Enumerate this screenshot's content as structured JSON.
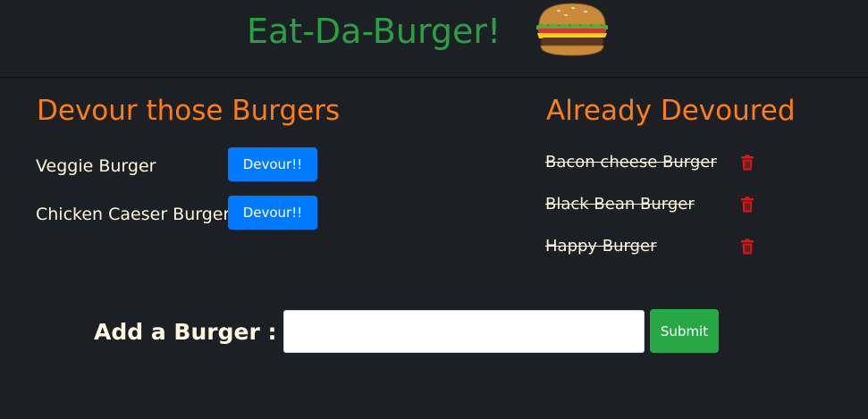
{
  "header": {
    "title": "Eat-Da-Burger!",
    "logo_icon": "burger-icon"
  },
  "devour_column": {
    "heading": "Devour those Burgers",
    "items": [
      {
        "name": "Veggie Burger",
        "button_label": "Devour!!"
      },
      {
        "name": "Chicken Caeser Burger",
        "button_label": "Devour!!"
      }
    ]
  },
  "devoured_column": {
    "heading": "Already Devoured",
    "items": [
      {
        "name": "Bacon cheese Burger",
        "icon": "trash-icon"
      },
      {
        "name": "Black Bean Burger",
        "icon": "trash-icon"
      },
      {
        "name": "Happy Burger",
        "icon": "trash-icon"
      }
    ]
  },
  "add_form": {
    "label": "Add a Burger :",
    "input_value": "",
    "submit_label": "Submit"
  },
  "colors": {
    "background": "#1c1f23",
    "title": "#2aa042",
    "heading": "#fd7e14",
    "devour_button": "#007bff",
    "submit_button": "#28a745",
    "trash": "#e01616"
  }
}
